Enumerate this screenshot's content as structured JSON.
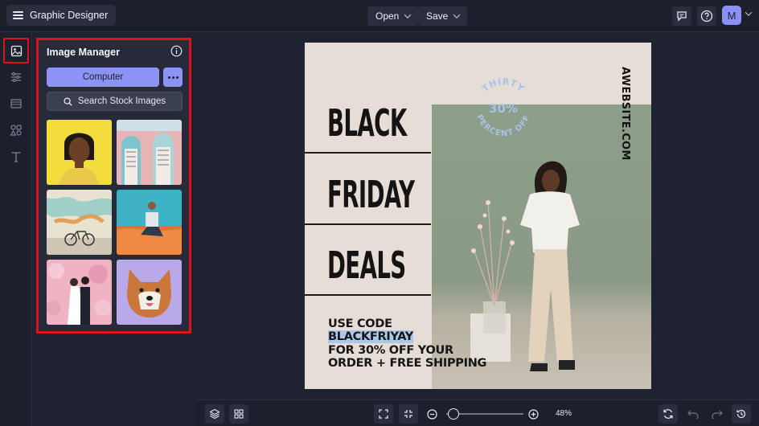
{
  "app": {
    "title": "Graphic Designer"
  },
  "topbar": {
    "open_label": "Open",
    "save_label": "Save",
    "avatar_letter": "M"
  },
  "panel": {
    "title": "Image Manager",
    "computer_label": "Computer",
    "search_label": "Search Stock Images",
    "thumbnails": [
      "woman-yellow-background",
      "pink-doors",
      "bicycle-mural",
      "man-desert",
      "wedding-couple-flowers",
      "shiba-dog-purple"
    ]
  },
  "design": {
    "stamp_top": "THIRTY",
    "stamp_number": "30%",
    "stamp_bottom": "PERCENT OFF",
    "word1": "BLACK",
    "word2": "FRIDAY",
    "word3": "DEALS",
    "promo_line1": "USE CODE",
    "promo_code": "BLACKFRIYAY",
    "promo_line3": "FOR 30% OFF YOUR",
    "promo_line4": "ORDER + FREE SHIPPING",
    "website": "AWEBSITE.COM"
  },
  "bottombar": {
    "zoom": "48%"
  },
  "colors": {
    "accent": "#8d92f5",
    "highlight_border": "#e0101c",
    "background": "#1f2231"
  }
}
